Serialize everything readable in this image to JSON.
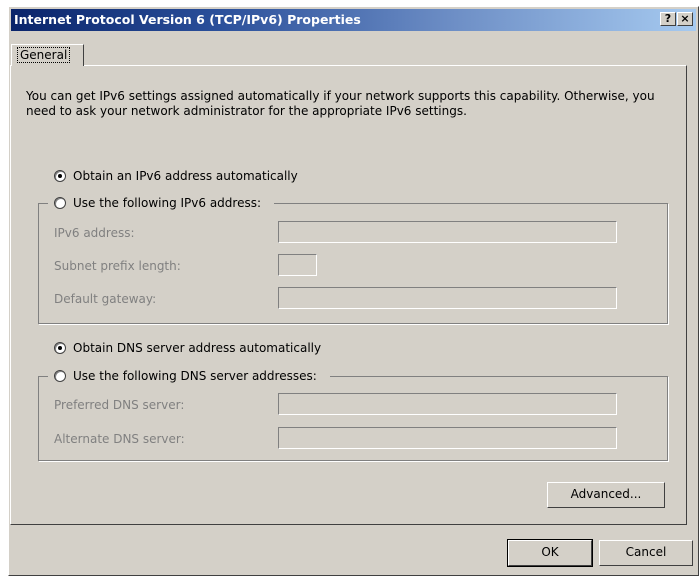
{
  "window": {
    "title": "Internet Protocol Version 6 (TCP/IPv6) Properties",
    "help_label": "?",
    "close_label": "×"
  },
  "tab": {
    "label": "General"
  },
  "description": "You can get IPv6 settings assigned automatically if your network supports this capability. Otherwise, you need to ask your network administrator for the appropriate IPv6 settings.",
  "ip": {
    "auto_label": "Obtain an IPv6 address automatically",
    "manual_label": "Use the following IPv6 address:",
    "selected": "auto",
    "fields": [
      {
        "label": "IPv6 address:",
        "value": ""
      },
      {
        "label": "Subnet prefix length:",
        "value": ""
      },
      {
        "label": "Default gateway:",
        "value": ""
      }
    ]
  },
  "dns": {
    "auto_label": "Obtain DNS server address automatically",
    "manual_label": "Use the following DNS server addresses:",
    "selected": "auto",
    "fields": [
      {
        "label": "Preferred DNS server:",
        "value": ""
      },
      {
        "label": "Alternate DNS server:",
        "value": ""
      }
    ]
  },
  "buttons": {
    "advanced": "Advanced...",
    "ok": "OK",
    "cancel": "Cancel"
  }
}
